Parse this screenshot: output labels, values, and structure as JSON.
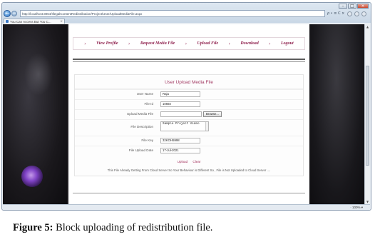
{
  "browser": {
    "url": "http://localhost:3064/IllegalContentRedistribution/Project/User/UploadMediaFile.aspx",
    "addr_controls": "ρ • ≡ C ×",
    "tab_title": "You Can Access But You C...",
    "tab_close": "×",
    "zoom": "· 100% ▾",
    "nav_back": "←",
    "nav_forward": "→",
    "window_controls": [
      "–",
      "□",
      "×"
    ]
  },
  "menu": {
    "separator": "›",
    "items": [
      "View Profile",
      "Request Media File",
      "Upload File",
      "Download",
      "Logout"
    ]
  },
  "form": {
    "title": "User Upload Media File",
    "fields": [
      {
        "label": "User Name",
        "value": "Raja"
      },
      {
        "label": "File Id",
        "value": "10692"
      },
      {
        "label": "Upload Media File",
        "value": ""
      },
      {
        "label": "File Description",
        "value": "Sample Project Video"
      },
      {
        "label": "File Key",
        "value": "32KOH5998"
      },
      {
        "label": "File Upload Date",
        "value": "17-Jul-2021"
      }
    ],
    "browse_label": "Browse...",
    "upload_label": "Upload",
    "clear_label": "Clear",
    "message": "This File Already Getting From Cloud Server So Your Behaviour is Different So , File is Not Uploaded to Cloud Server ...."
  },
  "caption": {
    "label": "Figure 5:",
    "text": " Block uploading of redistribution file."
  },
  "colors": {
    "accent": "#8e1f4c",
    "page_bg": "#1c1a1e",
    "panel_bg": "#ffffff"
  }
}
